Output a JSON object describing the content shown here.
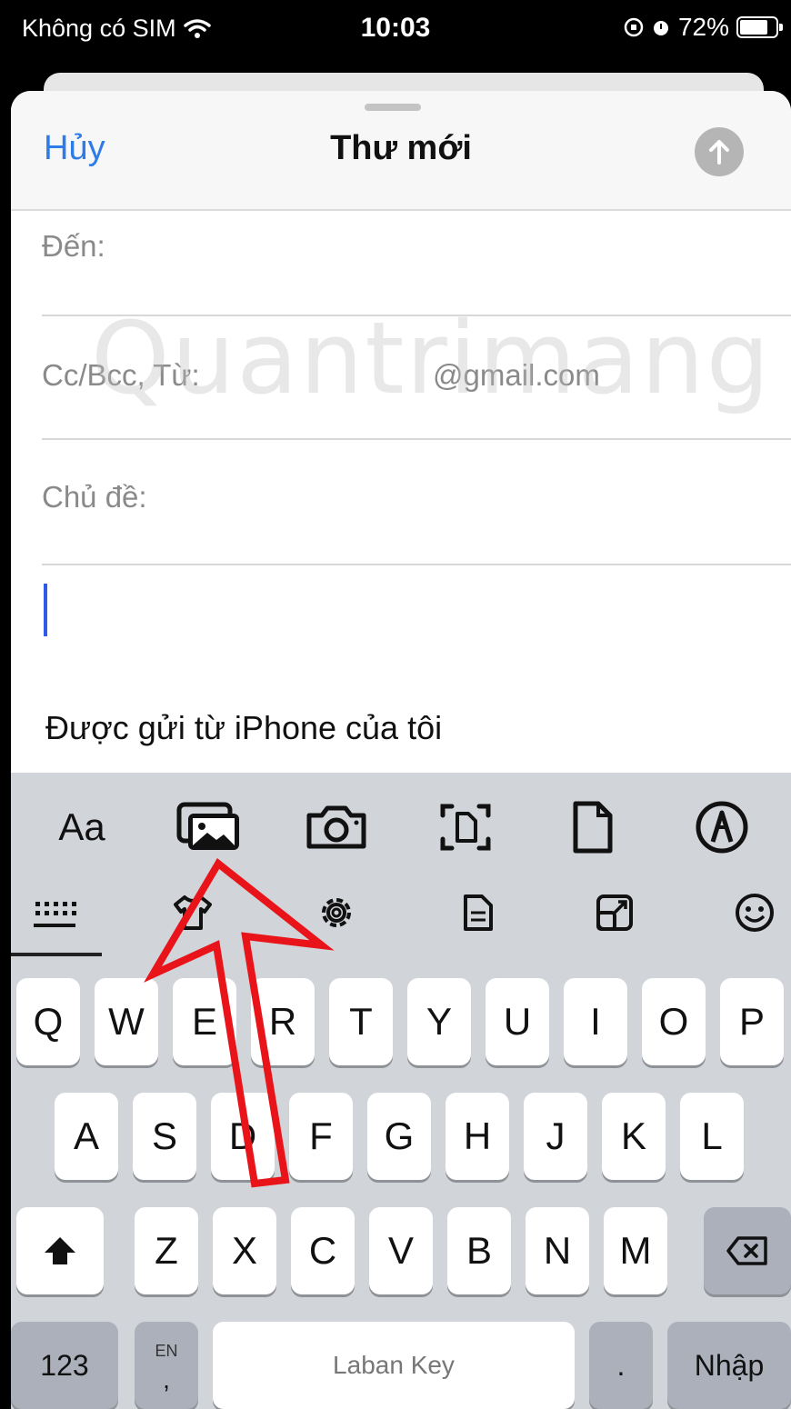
{
  "status_bar": {
    "carrier": "Không có SIM",
    "time": "10:03",
    "battery": "72%"
  },
  "compose": {
    "cancel_label": "Hủy",
    "title": "Thư mới",
    "to_label": "Đến:",
    "cc_label": "Cc/Bcc, Từ:",
    "cc_value": "@gmail.com",
    "subject_label": "Chủ đề:",
    "signature": "Được gửi từ iPhone của tôi"
  },
  "watermark": "Quantrimang",
  "format_toolbar": {
    "text_style_label": "Aa",
    "icons": [
      "photo-library-icon",
      "camera-icon",
      "scan-document-icon",
      "file-icon",
      "markup-icon"
    ]
  },
  "keyboard_toolbar": {
    "icons": [
      "keyboard-icon",
      "shirt-icon",
      "gear-icon",
      "document-icon",
      "resize-icon",
      "emoji-icon"
    ]
  },
  "keyboard": {
    "row1": [
      "Q",
      "W",
      "E",
      "R",
      "T",
      "Y",
      "U",
      "I",
      "O",
      "P"
    ],
    "row2": [
      "A",
      "S",
      "D",
      "F",
      "G",
      "H",
      "J",
      "K",
      "L"
    ],
    "row3": [
      "Z",
      "X",
      "C",
      "V",
      "B",
      "N",
      "M"
    ],
    "numbers_label": "123",
    "lang_label": "EN",
    "comma_label": ",",
    "space_label": "Laban Key",
    "period_label": ".",
    "return_label": "Nhập"
  },
  "colors": {
    "accent": "#2f7ce8",
    "annotation_arrow": "#e8141a"
  }
}
